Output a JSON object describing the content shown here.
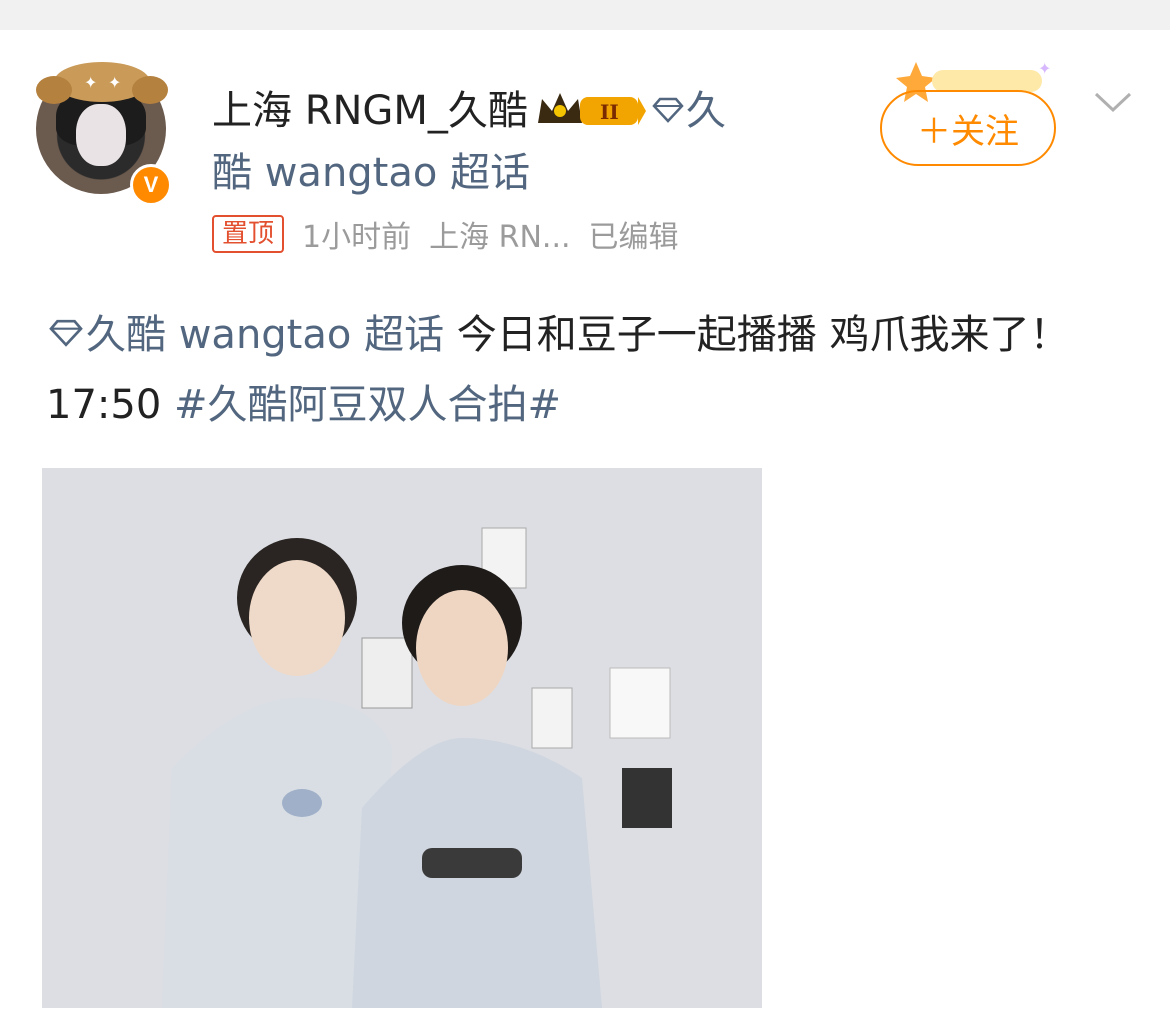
{
  "post": {
    "username": "上海 RNGM_久酷",
    "topic_line1": "久",
    "topic_line2": "酷 wangtao 超话",
    "follow_label": "＋关注",
    "pin_label": "置顶",
    "time": "1小时前",
    "source": "上海 RN...",
    "edited": "已编辑",
    "body_topic": "久酷 wangtao 超话",
    "body_text": " 今日和豆子一起播播 鸡爪我来了！ 17:50 ",
    "hashtag": "#久酷阿豆双人合拍#",
    "verified_mark": "V",
    "level_badge": "II"
  },
  "icons": {
    "topic": "diamond-icon",
    "menu": "chevron-down-icon",
    "verified": "verified-badge-icon",
    "level": "crown-level-badge"
  },
  "colors": {
    "accent": "#ff8a00",
    "link": "#52677f",
    "pin": "#e3502f",
    "muted": "#9b9b9b"
  }
}
